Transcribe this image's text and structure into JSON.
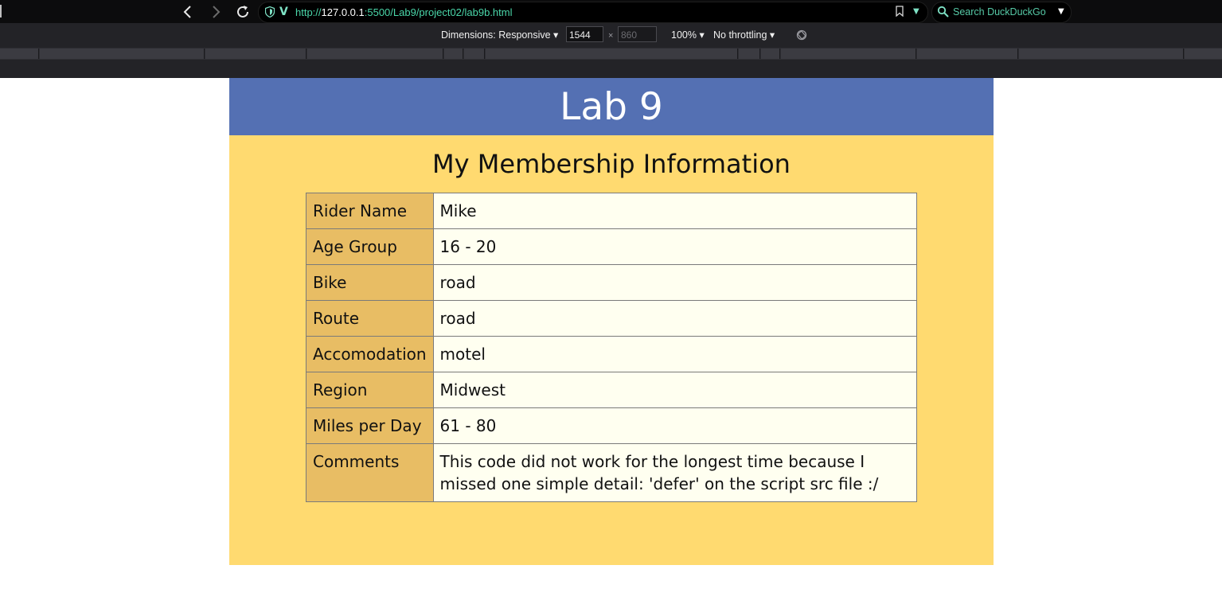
{
  "browser": {
    "url_scheme": "http://",
    "url_host": "127.0.0.1",
    "url_path": ":5500/Lab9/project02/lab9b.html",
    "search_placeholder": "Search DuckDuckGo"
  },
  "responsive_toolbar": {
    "dimensions_label": "Dimensions: Responsive",
    "width_value": "1544",
    "height_value": "860",
    "zoom": "100%",
    "throttling": "No throttling"
  },
  "page": {
    "header_title": "Lab 9",
    "section_title": "My Membership Information",
    "rows": [
      {
        "label": "Rider Name",
        "value": "Mike"
      },
      {
        "label": "Age Group",
        "value": "16 - 20"
      },
      {
        "label": "Bike",
        "value": "road"
      },
      {
        "label": "Route",
        "value": "road"
      },
      {
        "label": "Accomodation",
        "value": "motel"
      },
      {
        "label": "Region",
        "value": "Midwest"
      },
      {
        "label": "Miles per Day",
        "value": "61 - 80"
      },
      {
        "label": "Comments",
        "value": "This code did not work for the longest time because I missed one simple detail: 'defer' on the script src file :/"
      }
    ]
  },
  "colors": {
    "header_bg": "#5470b3",
    "page_bg": "#ffda70",
    "label_cell_bg": "#e8bd64",
    "value_cell_bg": "#fffff0",
    "url_accent": "#4ad6a9"
  },
  "icons": [
    "back-icon",
    "forward-icon",
    "reload-icon",
    "shield-icon",
    "vivaldi-icon",
    "bookmark-icon",
    "dropdown-icon",
    "search-icon",
    "rotate-icon"
  ]
}
